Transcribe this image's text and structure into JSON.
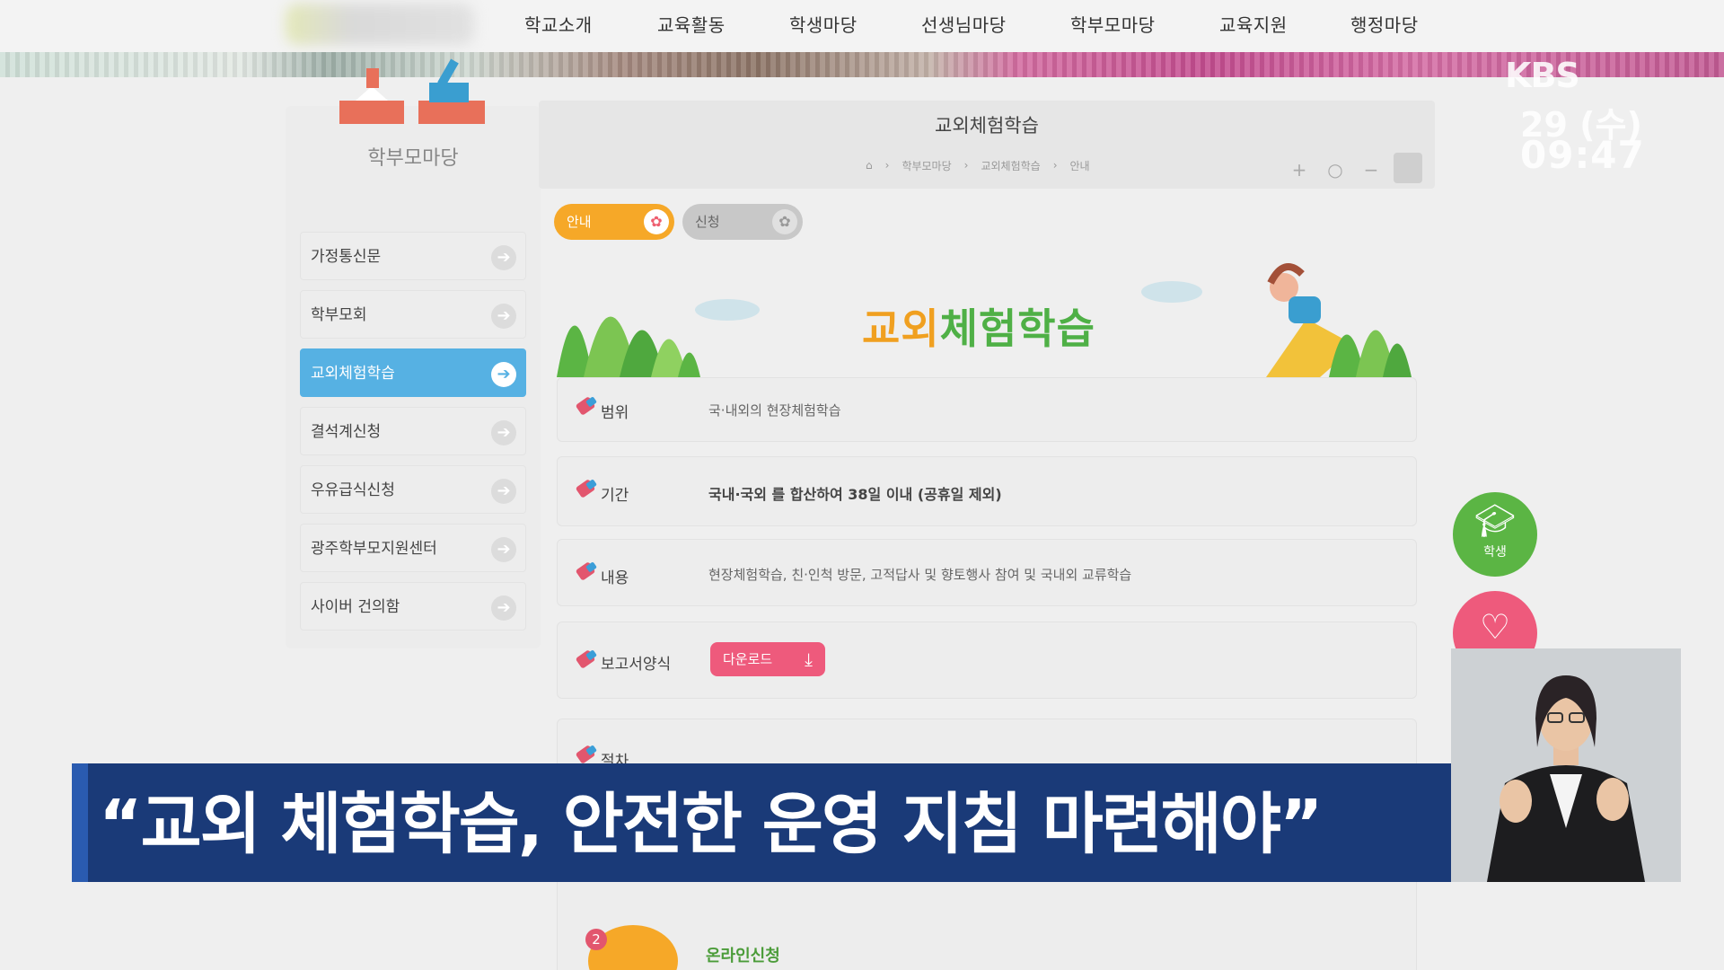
{
  "nav": {
    "items": [
      "학교소개",
      "교육활동",
      "학생마당",
      "선생님마당",
      "학부모마당",
      "교육지원",
      "행정마당"
    ]
  },
  "broadcast": {
    "logo": "KBS",
    "date": "29 (수)",
    "time": "09:47"
  },
  "sidebar": {
    "section_title": "학부모마당",
    "items": [
      {
        "label": "가정통신문"
      },
      {
        "label": "학부모회"
      },
      {
        "label": "교외체험학습",
        "active": true
      },
      {
        "label": "결석계신청"
      },
      {
        "label": "우유급식신청"
      },
      {
        "label": "광주학부모지원센터"
      },
      {
        "label": "사이버 건의함"
      }
    ]
  },
  "main": {
    "page_title": "교외체험학습",
    "breadcrumb": [
      "학부모마당",
      "교외체험학습",
      "안내"
    ],
    "tabs": [
      "안내",
      "신청"
    ],
    "hero_title_part1": "교외",
    "hero_title_part2": "체험학습",
    "rows": [
      {
        "label": "범위",
        "value": "국·내외의 현장체험학습"
      },
      {
        "label": "기간",
        "value": "국내·국외 를 합산하여 38일 이내 (공휴일 제외)"
      },
      {
        "label": "내용",
        "value": "현장체험학습, 친·인척 방문, 고적답사 및 향토행사 참여 및 국내외 교류학습"
      },
      {
        "label": "보고서양식",
        "button": "다운로드"
      },
      {
        "label": "절차"
      }
    ],
    "step": {
      "number": "2",
      "label": "온라인신청"
    }
  },
  "fab": {
    "student_label": "학생"
  },
  "caption": {
    "text": "“교외 체험학습, 안전한 운영 지침 마련해야”"
  },
  "colors": {
    "accent_blue": "#56b1e3",
    "tab_orange": "#f6a828",
    "download_pink": "#ee5a7c",
    "caption_navy": "#1a3a78",
    "student_green": "#5bb544"
  }
}
